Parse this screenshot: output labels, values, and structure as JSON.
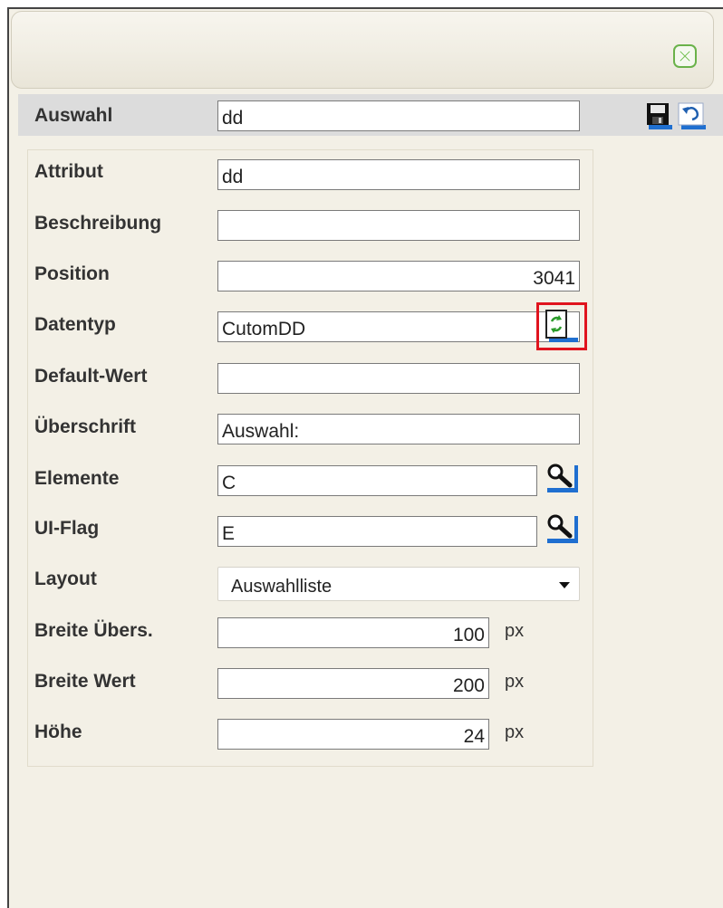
{
  "title_row": {
    "label": "Auswahl",
    "value": "dd"
  },
  "fields": {
    "attribut": {
      "label": "Attribut",
      "value": "dd"
    },
    "beschreibung": {
      "label": "Beschreibung",
      "value": ""
    },
    "position": {
      "label": "Position",
      "value": "3041"
    },
    "datentyp": {
      "label": "Datentyp",
      "value": "CutomDD"
    },
    "default_wert": {
      "label": "Default-Wert",
      "value": ""
    },
    "ueberschrift": {
      "label": "Überschrift",
      "value": "Auswahl:"
    },
    "elemente": {
      "label": "Elemente",
      "value": "C"
    },
    "ui_flag": {
      "label": "UI-Flag",
      "value": "E"
    },
    "layout": {
      "label": "Layout",
      "value": "Auswahlliste"
    },
    "breite_uebers": {
      "label": "Breite Übers.",
      "value": "100",
      "unit": "px"
    },
    "breite_wert": {
      "label": "Breite Wert",
      "value": "200",
      "unit": "px"
    },
    "hoehe": {
      "label": "Höhe",
      "value": "24",
      "unit": "px"
    }
  },
  "icons": {
    "close": "close-icon",
    "save": "save-icon",
    "undo": "undo-icon",
    "refresh": "refresh-icon",
    "lookup": "magnifier-icon"
  },
  "colors": {
    "highlight": "#e0141e",
    "close_accent": "#6ab24a",
    "icon_blue": "#1f6fd0"
  }
}
